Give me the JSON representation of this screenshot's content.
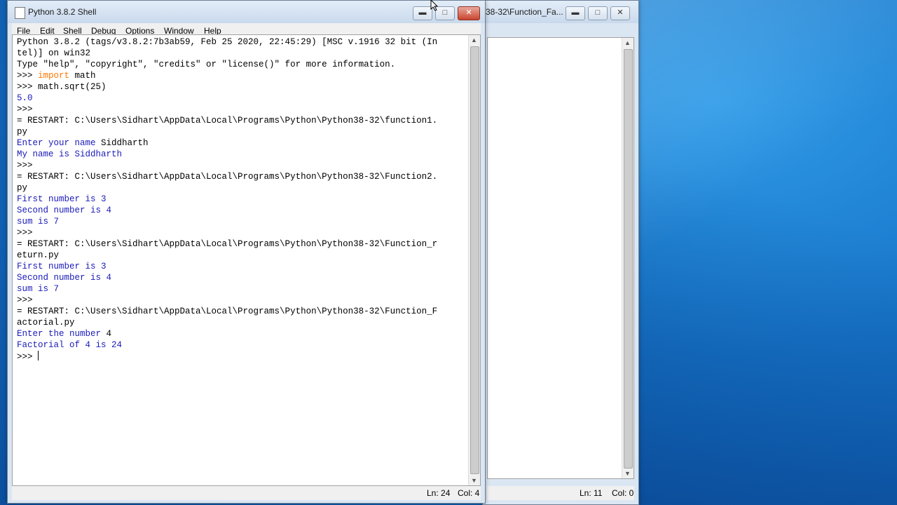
{
  "shell_window": {
    "title": "Python 3.8.2 Shell",
    "menus": [
      "File",
      "Edit",
      "Shell",
      "Debug",
      "Options",
      "Window",
      "Help"
    ],
    "lines": [
      {
        "t": "Python 3.8.2 (tags/v3.8.2:7b3ab59, Feb 25 2020, 22:45:29) [MSC v.1916 32 bit (In",
        "k": "plain"
      },
      {
        "t": "tel)] on win32",
        "k": "plain"
      },
      {
        "t": "Type \"help\", \"copyright\", \"credits\" or \"license()\" for more information.",
        "k": "plain"
      },
      {
        "t": "math",
        "k": "import",
        "prompt": ">>> ",
        "keyword": "import"
      },
      {
        "t": ">>> math.sqrt(25)",
        "k": "plain"
      },
      {
        "t": "5.0",
        "k": "out"
      },
      {
        "t": ">>> ",
        "k": "plain"
      },
      {
        "t": "= RESTART: C:\\Users\\Sidhart\\AppData\\Local\\Programs\\Python\\Python38-32\\function1.",
        "k": "plain"
      },
      {
        "t": "py",
        "k": "plain"
      },
      {
        "t": "Enter your name ",
        "k": "out",
        "input": "Siddharth"
      },
      {
        "t": "My name is Siddharth",
        "k": "out"
      },
      {
        "t": ">>> ",
        "k": "plain"
      },
      {
        "t": "= RESTART: C:\\Users\\Sidhart\\AppData\\Local\\Programs\\Python\\Python38-32\\Function2.",
        "k": "plain"
      },
      {
        "t": "py",
        "k": "plain"
      },
      {
        "t": "First number is 3",
        "k": "out"
      },
      {
        "t": "Second number is 4",
        "k": "out"
      },
      {
        "t": "sum is 7",
        "k": "out"
      },
      {
        "t": ">>> ",
        "k": "plain"
      },
      {
        "t": "= RESTART: C:\\Users\\Sidhart\\AppData\\Local\\Programs\\Python\\Python38-32\\Function_r",
        "k": "plain"
      },
      {
        "t": "eturn.py",
        "k": "plain"
      },
      {
        "t": "First number is 3",
        "k": "out"
      },
      {
        "t": "Second number is 4",
        "k": "out"
      },
      {
        "t": "sum is 7",
        "k": "out"
      },
      {
        "t": ">>> ",
        "k": "plain"
      },
      {
        "t": "= RESTART: C:\\Users\\Sidhart\\AppData\\Local\\Programs\\Python\\Python38-32\\Function_F",
        "k": "plain"
      },
      {
        "t": "actorial.py",
        "k": "plain"
      },
      {
        "t": "Enter the number ",
        "k": "out",
        "input": "4"
      },
      {
        "t": "Factorial of 4 is 24",
        "k": "out"
      },
      {
        "t": ">>> ",
        "k": "prompt_caret"
      }
    ],
    "status": {
      "line": "Ln: 24",
      "col": "Col: 4"
    }
  },
  "editor_window": {
    "title_fragment": "38-32\\Function_Fa...",
    "status": {
      "line": "Ln: 11",
      "col": "Col: 0"
    }
  },
  "colors": {
    "output": "#1a1ab8",
    "keyword": "#ff7700"
  }
}
